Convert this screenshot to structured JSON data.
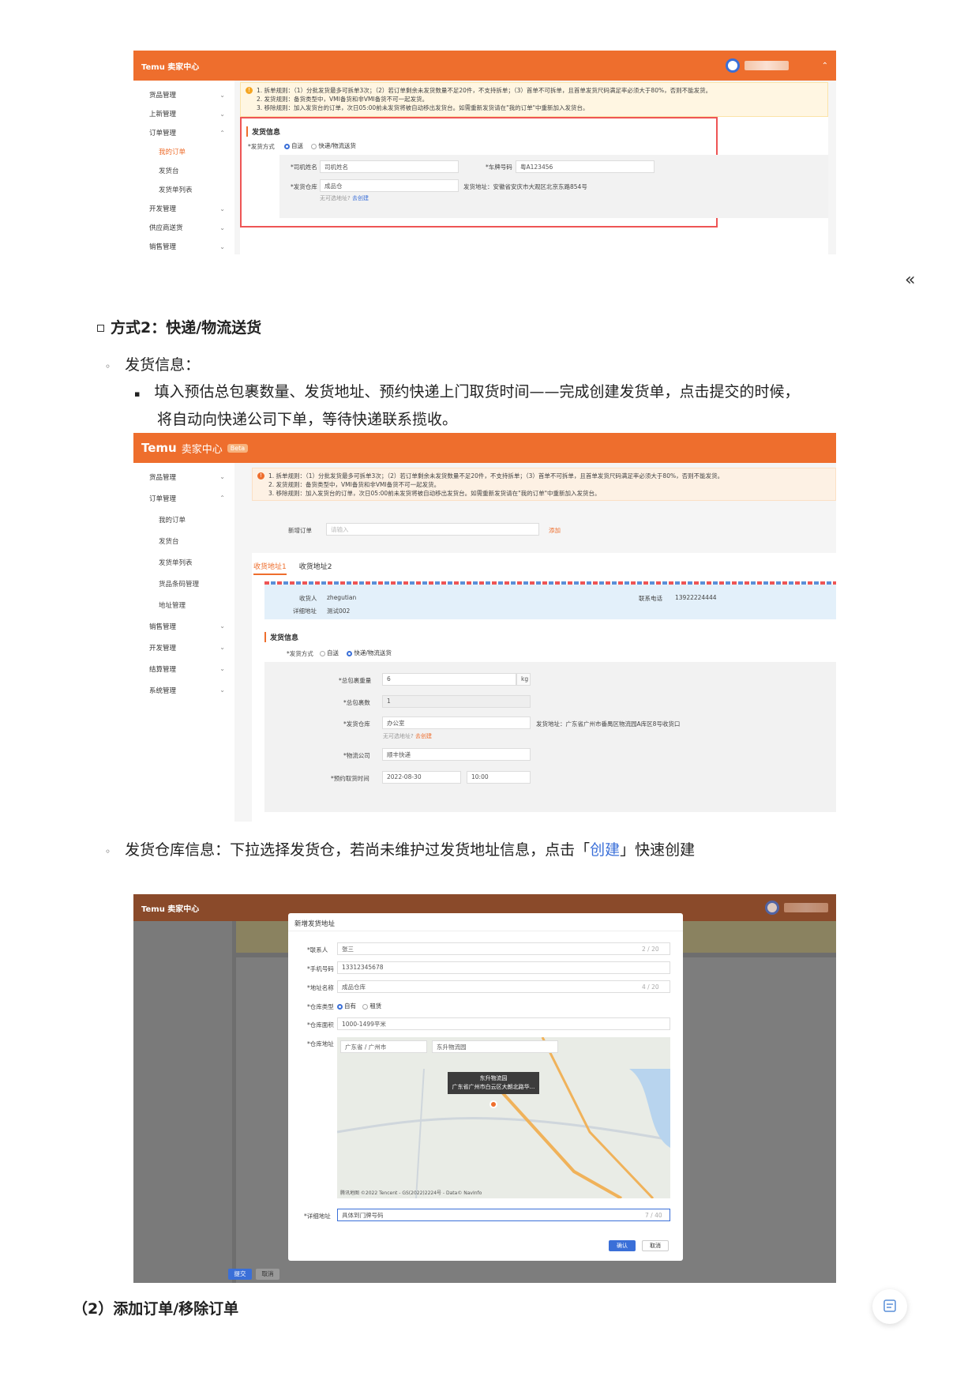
{
  "shot1": {
    "logo": "Temu 卖家中心",
    "sidebar": [
      "货品管理",
      "上新管理",
      "订单管理",
      "我的订单",
      "发货台",
      "发货单列表",
      "开发管理",
      "供应商送货",
      "销售管理"
    ],
    "notice": [
      "1. 拆单规则：（1）分批发货最多可拆单3次；（2）若订单剩余未发货数量不足20件，不支持拆单；（3）首单不可拆单，且首单发货尺码满足率必须大于80%，否则不能发货。",
      "2. 发货规则：备货类型中，VMI备货和非VMI备货不可一起发货。",
      "3. 移除规则：加入发货台的订单，次日05:00前未发货将被自动移出发货台。如需重新发货请在\"我的订单\"中重新加入发货台。"
    ],
    "section_title": "发货信息",
    "ship_method_label": "*发货方式",
    "opt_self": "自送",
    "opt_express": "快递/物流送货",
    "driver_label": "*司机姓名",
    "driver_value": "司机姓名",
    "plate_label": "*车牌号码",
    "plate_value": "粤A123456",
    "warehouse_label": "*发货仓库",
    "warehouse_value": "成品仓",
    "address_text": "发货地址：安徽省安庆市大观区北京东路854号",
    "no_addr": "无可选地址?",
    "create_link": "去创建"
  },
  "collapse_icon": "«",
  "heading_method2": "方式2：快递/物流送货",
  "bullet_ship_info": "发货信息：",
  "bullet_fill_line1": "填入预估总包裹数量、发货地址、预约快递上门取货时间——完成创建发货单，点击提交的时候，",
  "bullet_fill_line2": "将自动向快递公司下单，等待快递联系揽收。",
  "shot2": {
    "logo": "Temu",
    "logo_sub": "卖家中心",
    "beta": "Beta",
    "sidebar": [
      "货品管理",
      "订单管理",
      "我的订单",
      "发货台",
      "发货单列表",
      "货品条码管理",
      "地址管理",
      "销售管理",
      "开发管理",
      "结算管理",
      "系统管理"
    ],
    "notice": [
      "1. 拆单规则：（1）分批发货最多可拆单3次；（2）若订单剩余未发货数量不足20件，不支持拆单；（3）首单不可拆单，且首单发货尺码满足率必须大于80%，否则不能发货。",
      "2. 发货规则：备货类型中，VMI备货和非VMI备货不可一起发货。",
      "3. 移除规则：加入发货台的订单，次日05:00前未发货将被自动移出发货台。如需重新发货请在\"我的订单\"中重新加入发货台。"
    ],
    "add_order_label": "新增订单",
    "add_order_placeholder": "请输入",
    "add_btn": "添加",
    "tab1": "收货地址1",
    "tab2": "收货地址2",
    "receiver_label": "收货人",
    "receiver_value": "zhegutian",
    "phone_label": "联系电话",
    "phone_value": "13922224444",
    "detail_label": "详细地址",
    "detail_value": "测试002",
    "section_title": "发货信息",
    "ship_method_label": "*发货方式",
    "opt_self": "自送",
    "opt_express": "快递/物流送货",
    "weight_label": "*总包裹重量",
    "weight_value": "6",
    "weight_unit": "kg",
    "count_label": "*总包裹数",
    "count_value": "1",
    "warehouse_label": "*发货仓库",
    "warehouse_value": "办公室",
    "address_text": "发货地址：广东省广州市番禺区物流园A库区8号收货口",
    "no_addr": "无可选地址?",
    "create_link": "去创建",
    "carrier_label": "*物流公司",
    "carrier_value": "顺丰快递",
    "pickup_label": "*预约取货时间",
    "pickup_date": "2022-08-30",
    "pickup_time": "10:00"
  },
  "bullet_wh_prefix": "发货仓库信息：下拉选择发货仓，若尚未维护过发货地址信息，点击「",
  "bullet_wh_link": "创建",
  "bullet_wh_suffix": "」快速创建",
  "shot3": {
    "logo": "Temu 卖家中心",
    "modal_title": "新增发货地址",
    "contact_label": "*联系人",
    "contact_value": "张三",
    "contact_count": "2 / 20",
    "mobile_label": "*手机号码",
    "mobile_value": "13312345678",
    "addrname_label": "*地址名称",
    "addrname_value": "成品仓库",
    "addrname_count": "4 / 20",
    "whtype_label": "*仓库类型",
    "whtype_own": "自有",
    "whtype_rent": "租赁",
    "area_label": "*仓库面积",
    "area_value": "1000-1499平米",
    "whaddr_label": "*仓库地址",
    "region_value": "广东省 / 广州市",
    "search_value": "东升物流园",
    "map_popup_title": "东升物流园",
    "map_popup_addr": "广东省广州市白云区大朗北路华...",
    "map_credit": "腾讯地图 ©2022 Tencent - GS(2022)2224号 - Data© NavInfo",
    "detail_label": "*详细地址",
    "detail_value": "具体到门牌号码",
    "detail_count": "7 / 40",
    "confirm": "确认",
    "cancel": "取消",
    "submit": "提交",
    "cancel2": "取消"
  },
  "heading_add_remove": "（2）添加订单/移除订单",
  "watermark": "dailishi"
}
